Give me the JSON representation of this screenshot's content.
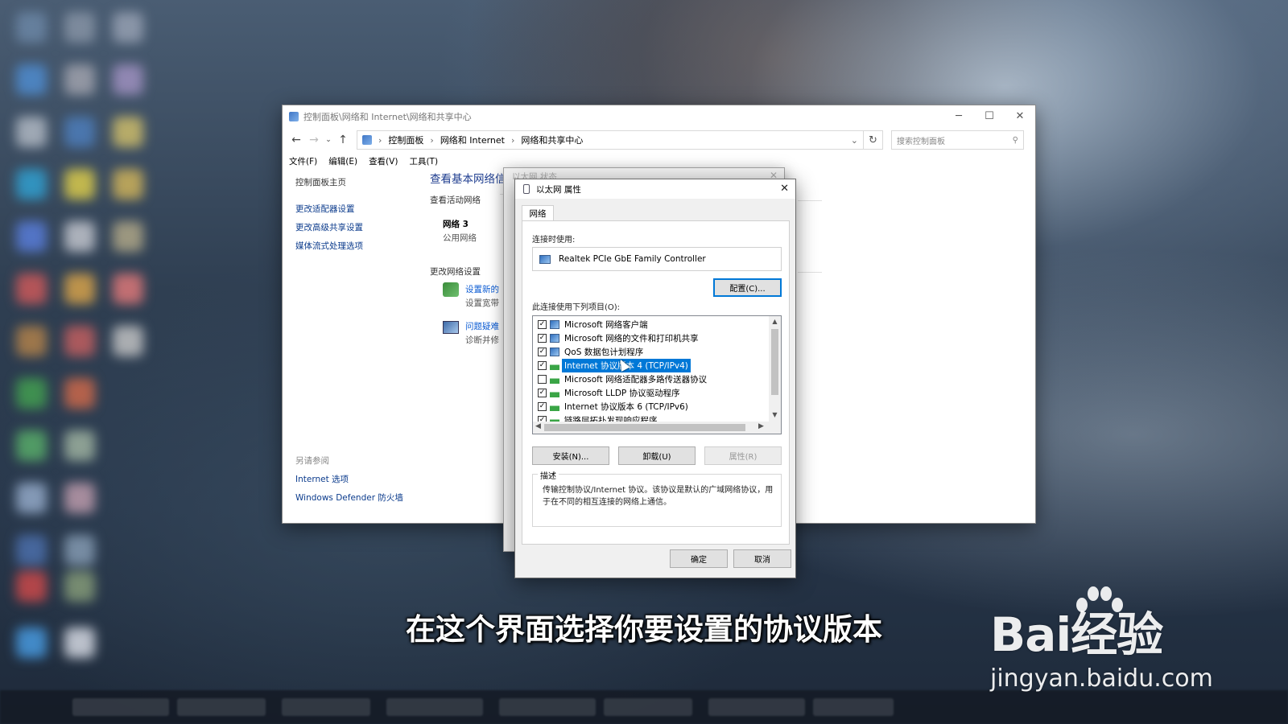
{
  "window": {
    "title": "控制面板\\网络和 Internet\\网络和共享中心",
    "controls": {
      "minimize": "─",
      "maximize": "☐",
      "close": "✕"
    }
  },
  "address_bar": {
    "crumbs": [
      "控制面板",
      "网络和 Internet",
      "网络和共享中心"
    ],
    "search_placeholder": "搜索控制面板"
  },
  "menu": [
    "文件(F)",
    "编辑(E)",
    "查看(V)",
    "工具(T)"
  ],
  "left_pane": {
    "home": "控制面板主页",
    "links": [
      "更改适配器设置",
      "更改高级共享设置",
      "媒体流式处理选项"
    ],
    "see_also_header": "另请参阅",
    "see_also": [
      "Internet 选项",
      "Windows Defender 防火墙"
    ]
  },
  "content": {
    "title": "查看基本网络信",
    "active_networks": "查看活动网络",
    "network_name": "网络 3",
    "network_type": "公用网络",
    "change_settings": "更改网络设置",
    "setup_link": "设置新的",
    "setup_desc": "设置宽带",
    "troubleshoot_link": "问题疑难",
    "troubleshoot_desc": "诊断并修"
  },
  "status_dialog": {
    "title": "以太网 状态"
  },
  "properties_dialog": {
    "title": "以太网 属性",
    "tab": "网络",
    "connect_using_label": "连接时使用:",
    "adapter": "Realtek PCIe GbE Family Controller",
    "configure_button": "配置(C)...",
    "items_label": "此连接使用下列项目(O):",
    "items": [
      {
        "label": "Microsoft 网络客户端",
        "checked": true,
        "icon": "client-icon"
      },
      {
        "label": "Microsoft 网络的文件和打印机共享",
        "checked": true,
        "icon": "client-icon"
      },
      {
        "label": "QoS 数据包计划程序",
        "checked": true,
        "icon": "client-icon"
      },
      {
        "label": "Internet 协议版本 4 (TCP/IPv4)",
        "checked": true,
        "icon": "protocol-icon",
        "selected": true
      },
      {
        "label": "Microsoft 网络适配器多路传送器协议",
        "checked": false,
        "icon": "protocol-icon"
      },
      {
        "label": "Microsoft LLDP 协议驱动程序",
        "checked": true,
        "icon": "protocol-icon"
      },
      {
        "label": "Internet 协议版本 6 (TCP/IPv6)",
        "checked": true,
        "icon": "protocol-icon"
      },
      {
        "label": "链路层拓扑发现响应程序",
        "checked": true,
        "icon": "protocol-icon"
      }
    ],
    "install_button": "安装(N)...",
    "uninstall_button": "卸载(U)",
    "properties_button": "属性(R)",
    "description_legend": "描述",
    "description": "传输控制协议/Internet 协议。该协议是默认的广域网络协议，用于在不同的相互连接的网络上通信。",
    "ok_button": "确定",
    "cancel_button": "取消"
  },
  "subtitle": "在这个界面选择你要设置的协议版本",
  "watermark": {
    "logo": "Bai经验",
    "url": "jingyan.baidu.com"
  }
}
